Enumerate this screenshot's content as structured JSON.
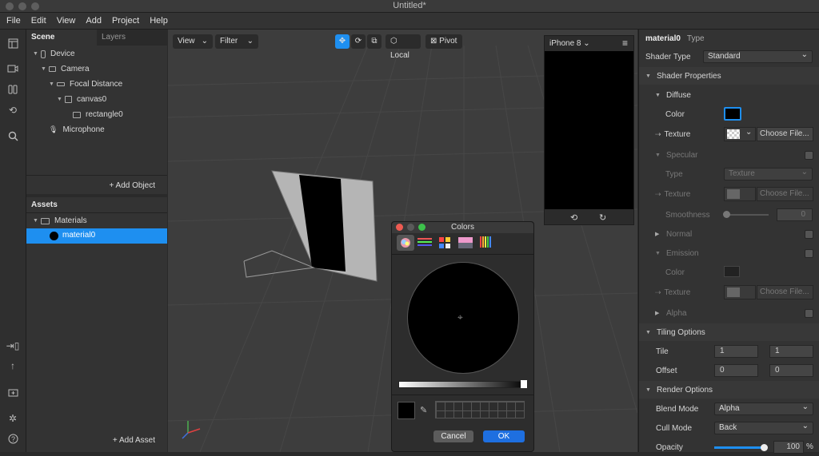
{
  "window": {
    "title": "Untitled*"
  },
  "menu": [
    "File",
    "Edit",
    "View",
    "Add",
    "Project",
    "Help"
  ],
  "scene": {
    "tab_scene": "Scene",
    "tab_layers": "Layers",
    "items": [
      "Device",
      "Camera",
      "Focal Distance",
      "canvas0",
      "rectangle0",
      "Microphone"
    ],
    "add_object": "+ Add Object"
  },
  "assets": {
    "title": "Assets",
    "folder": "Materials",
    "item": "material0",
    "add_asset": "+ Add Asset"
  },
  "viewport": {
    "view": "View",
    "filter": "Filter",
    "local": "Local",
    "pivot": "Pivot"
  },
  "device": {
    "name": "iPhone 8"
  },
  "colors": {
    "title": "Colors",
    "cancel": "Cancel",
    "ok": "OK"
  },
  "inspector": {
    "name": "material0",
    "type": "Type",
    "shader_type_label": "Shader Type",
    "shader_type": "Standard",
    "shader_props": "Shader Properties",
    "diffuse": "Diffuse",
    "color": "Color",
    "texture": "Texture",
    "choose": "Choose File...",
    "specular": "Specular",
    "type_value": "Texture",
    "smoothness": "Smoothness",
    "smooth_value": "0",
    "normal": "Normal",
    "emission": "Emission",
    "alpha": "Alpha",
    "tiling": "Tiling Options",
    "tile": "Tile",
    "tile_x": "1",
    "tile_y": "1",
    "offset": "Offset",
    "off_x": "0",
    "off_y": "0",
    "render": "Render Options",
    "blend_label": "Blend Mode",
    "blend": "Alpha",
    "cull_label": "Cull Mode",
    "cull": "Back",
    "opacity_label": "Opacity",
    "opacity": "100",
    "opacity_unit": "%"
  }
}
